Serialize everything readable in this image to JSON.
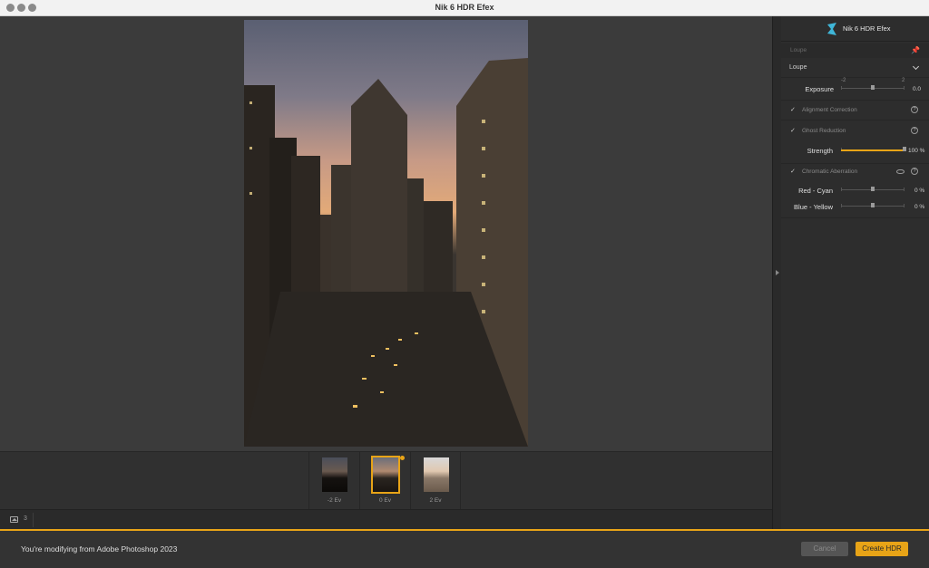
{
  "window": {
    "title": "Nik 6 HDR Efex"
  },
  "brand": {
    "name": "Nik 6 HDR Efex",
    "logo_icon": "nik-logo-icon"
  },
  "panel": {
    "loupe_header": "Loupe",
    "loupe_section": "Loupe",
    "exposure": {
      "label": "Exposure",
      "min_label": "-2",
      "max_label": "2",
      "value": "0.0"
    },
    "alignment": {
      "label": "Alignment Correction",
      "checked": true
    },
    "ghost": {
      "label": "Ghost Reduction",
      "checked": true
    },
    "strength": {
      "label": "Strength",
      "value": "100 %"
    },
    "chromatic": {
      "label": "Chromatic Aberration",
      "checked": true
    },
    "red_cyan": {
      "label": "Red - Cyan",
      "value": "0 %"
    },
    "blue_yellow": {
      "label": "Blue - Yellow",
      "value": "0 %"
    }
  },
  "filmstrip": {
    "thumbs": [
      {
        "label": "-2 Ev"
      },
      {
        "label": "0 Ev"
      },
      {
        "label": "2 Ev"
      }
    ]
  },
  "toolbar": {
    "count": "3"
  },
  "status": {
    "text": "You're modifying from Adobe Photoshop 2023"
  },
  "buttons": {
    "cancel": "Cancel",
    "create": "Create HDR"
  },
  "colors": {
    "accent": "#e8a417"
  }
}
